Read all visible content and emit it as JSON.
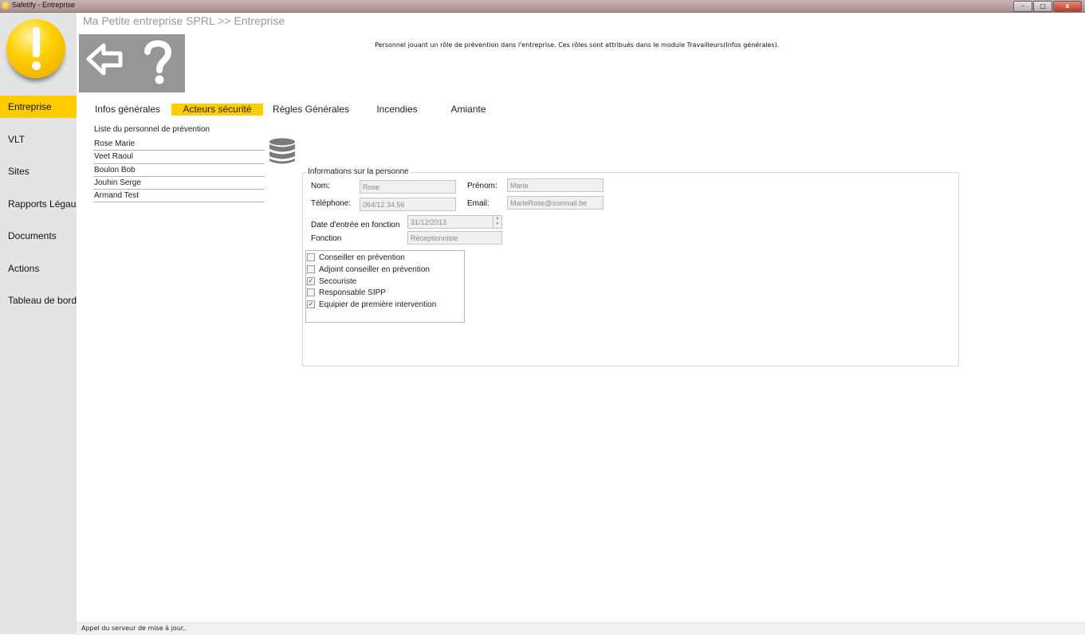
{
  "window": {
    "title": "Safetify - Entreprise",
    "controls": [
      "–",
      "□",
      "x"
    ]
  },
  "sidebar": {
    "items": [
      {
        "label": "Entreprise",
        "active": true
      },
      {
        "label": "VLT",
        "active": false
      },
      {
        "label": "Sites",
        "active": false
      },
      {
        "label": "Rapports Légaux",
        "active": false
      },
      {
        "label": "Documents",
        "active": false
      },
      {
        "label": "Actions",
        "active": false
      },
      {
        "label": "Tableau de bord",
        "active": false
      }
    ]
  },
  "header": {
    "breadcrumb": "Ma Petite entreprise SPRL >> Entreprise",
    "description": "Personnel jouant un rôle de prévention dans l'entreprise. Ces rôles sont attribués dans le module Travailleurs(Infos générales).",
    "toolbar": {
      "back_icon": "arrow-left-icon",
      "help_icon": "question-mark-icon"
    }
  },
  "tabs": [
    {
      "label": "Infos générales",
      "active": false
    },
    {
      "label": "Acteurs sécurité",
      "active": true
    },
    {
      "label": "Règles Générales",
      "active": false
    },
    {
      "label": "Incendies",
      "active": false
    },
    {
      "label": "Amiante",
      "active": false
    }
  ],
  "personnel": {
    "title": "Liste du personnel de prévention",
    "items": [
      "Rose Marie",
      "Veet Raoul",
      "Boulon Bob",
      "Jouhin Serge",
      "Armand Test"
    ],
    "db_icon": "database-icon"
  },
  "person_info": {
    "legend": "Informations sur la personne",
    "nom_label": "Nom:",
    "nom_value": "Rose",
    "prenom_label": "Prénom:",
    "prenom_value": "Marie",
    "telephone_label": "Téléphone:",
    "telephone_value": "064/12.34.56",
    "email_label": "Email:",
    "email_value": "MarieRose@sonmail.be",
    "date_label": "Date d'entrée en fonction",
    "date_value": "31/12/2013",
    "fonction_label": "Fonction",
    "fonction_value": "Réceptionniste",
    "roles": [
      {
        "label": "Conseiller en prévention",
        "checked": false
      },
      {
        "label": "Adjoint conseiller en prévention",
        "checked": false
      },
      {
        "label": "Secouriste",
        "checked": true
      },
      {
        "label": "Responsable SIPP",
        "checked": false
      },
      {
        "label": "Equipier de première intervention",
        "checked": true
      }
    ]
  },
  "status": {
    "text": "Appel du serveur de mise à jour.."
  },
  "colors": {
    "accent": "#ffcc00",
    "sidebar_bg": "#e4e4e4",
    "toolbar_bg": "#969696"
  }
}
